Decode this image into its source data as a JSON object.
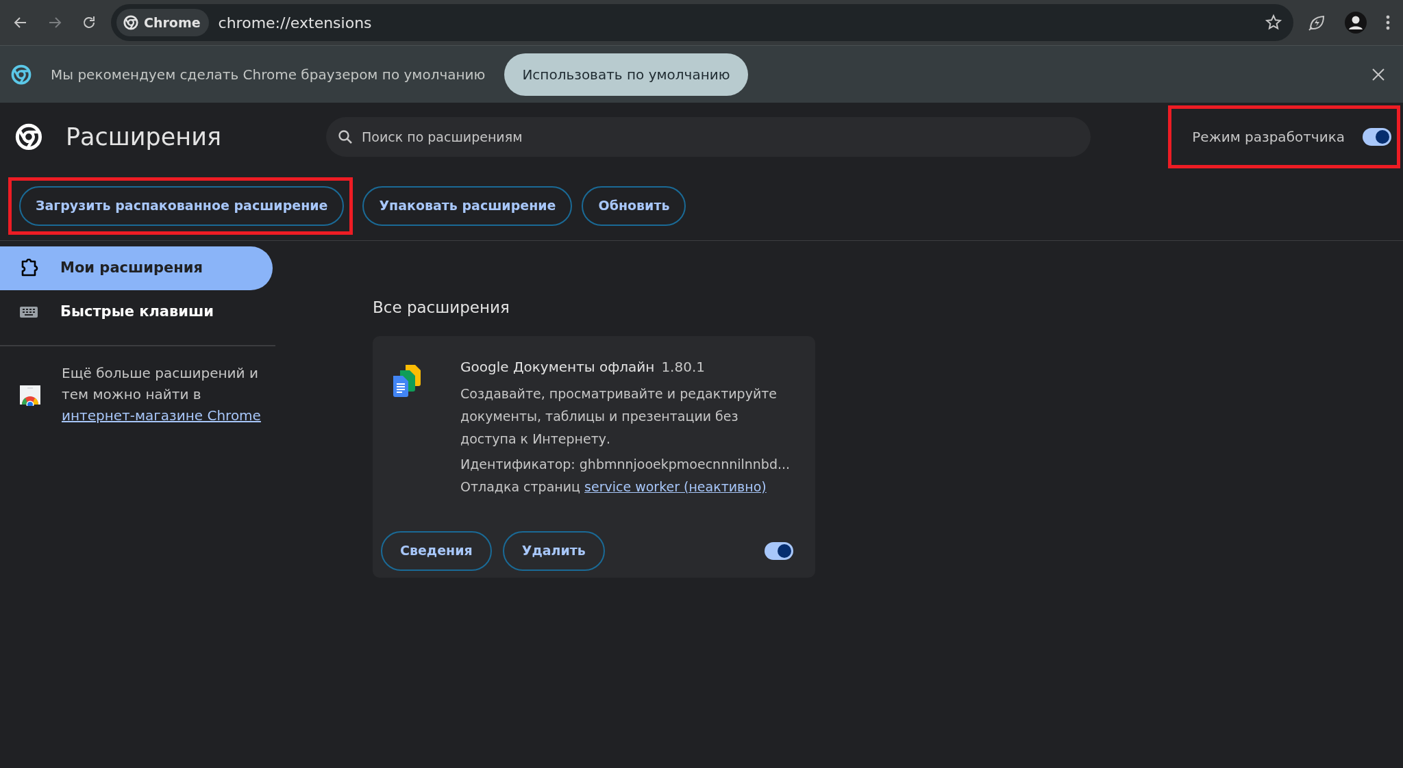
{
  "toolbar": {
    "back_disabled": false,
    "forward_disabled": true,
    "site_chip": "Chrome",
    "url": "chrome://extensions"
  },
  "infobar": {
    "message": "Мы рекомендуем сделать Chrome браузером по умолчанию",
    "button": "Использовать по умолчанию"
  },
  "header": {
    "title": "Расширения",
    "search": {
      "placeholder": "Поиск по расширениям"
    },
    "developer_mode": {
      "label": "Режим разработчика",
      "on": true,
      "highlighted": true
    }
  },
  "dev_buttons": [
    {
      "label": "Загрузить распакованное расширение",
      "highlighted": true
    },
    {
      "label": "Упаковать расширение",
      "highlighted": false
    },
    {
      "label": "Обновить",
      "highlighted": false
    }
  ],
  "sidebar": {
    "items": [
      {
        "kind": "puzzle",
        "label": "Мои расширения",
        "selected": true
      },
      {
        "kind": "keyboard",
        "label": "Быстрые клавиши",
        "selected": false
      }
    ],
    "promo": {
      "text": "Ещё больше расширений и тем можно найти в",
      "link": "интернет-магазине Chrome"
    }
  },
  "section_title": "Все расширения",
  "extensions": [
    {
      "name": "Google Документы офлайн",
      "version": "1.80.1",
      "description": "Создавайте, просматривайте и редактируйте документы, таблицы и презентации без доступа к Интернету.",
      "id_line": "Идентификатор: ghbmnnjooekpmoecnnnilnnbd...",
      "inspect_label": "Отладка страниц",
      "inspect_link": "service worker (неактивно)",
      "buttons": [
        "Сведения",
        "Удалить"
      ],
      "enabled": true
    }
  ]
}
